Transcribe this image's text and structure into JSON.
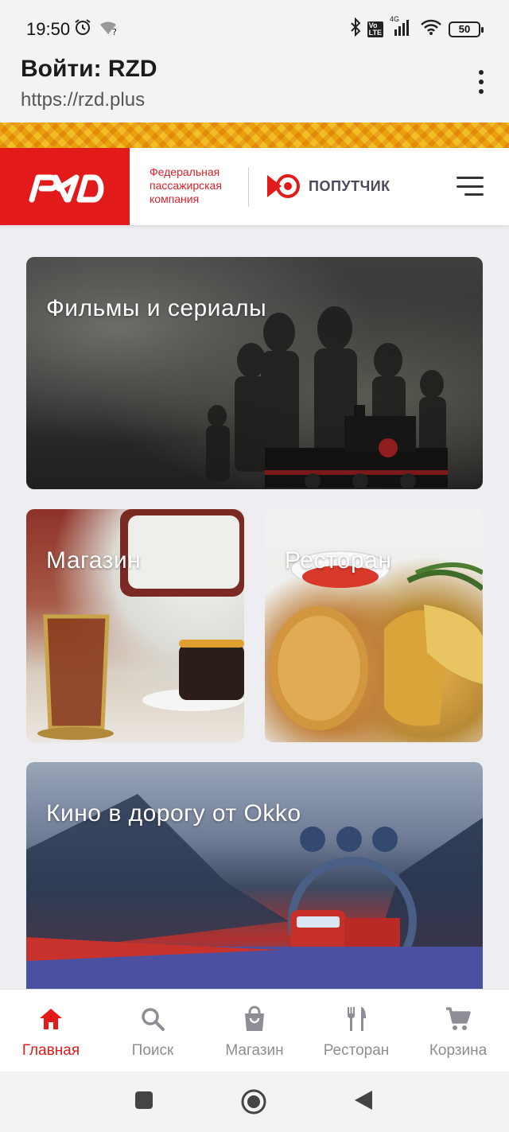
{
  "status_bar": {
    "time": "19:50",
    "battery": "50",
    "network": "4G",
    "icons": [
      "alarm-icon",
      "wifi-unknown-icon",
      "bluetooth-icon",
      "volte-icon",
      "signal-icon",
      "wifi-icon",
      "battery-icon"
    ]
  },
  "browser": {
    "title": "Войти: RZD",
    "url": "https://rzd.plus"
  },
  "header": {
    "logo_alt": "РЖД",
    "company_lines": [
      "Федеральная",
      "пассажирская",
      "компания"
    ],
    "partner_label": "ПОПУТЧИК"
  },
  "cards": {
    "films": "Фильмы и сериалы",
    "shop": "Магазин",
    "restaurant": "Ресторан",
    "okko": "Кино в дорогу от Okko"
  },
  "nav": {
    "items": [
      {
        "label": "Главная",
        "icon": "home-icon",
        "active": true
      },
      {
        "label": "Поиск",
        "icon": "search-icon",
        "active": false
      },
      {
        "label": "Магазин",
        "icon": "shopping-bag-icon",
        "active": false
      },
      {
        "label": "Ресторан",
        "icon": "fork-knife-icon",
        "active": false
      },
      {
        "label": "Корзина",
        "icon": "cart-icon",
        "active": false
      }
    ]
  },
  "colors": {
    "brand_red": "#e21a1a",
    "nav_inactive": "#8d8d96",
    "background": "#eeeef2"
  }
}
